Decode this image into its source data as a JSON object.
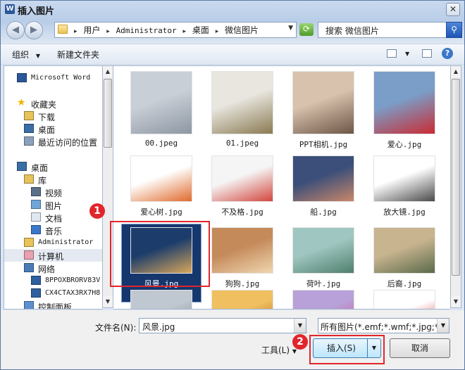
{
  "window": {
    "title": "插入图片",
    "app_icon": "W",
    "close_glyph": "✕"
  },
  "nav": {
    "back_glyph": "◀",
    "forward_glyph": "▶",
    "breadcrumbs": [
      "用户",
      "Administrator",
      "桌面",
      "微信图片"
    ],
    "search_placeholder": "搜索 微信图片"
  },
  "toolbar": {
    "organize": "组织",
    "new_folder": "新建文件夹",
    "help_glyph": "?"
  },
  "sidebar": {
    "items": [
      {
        "label": "Microsoft Word",
        "icon": "word-icon",
        "indent": 0
      },
      {
        "label": "收藏夹",
        "icon": "star-icon",
        "indent": 0
      },
      {
        "label": "下载",
        "icon": "download-folder-icon",
        "indent": 1
      },
      {
        "label": "桌面",
        "icon": "desktop-icon",
        "indent": 1
      },
      {
        "label": "最近访问的位置",
        "icon": "recent-places-icon",
        "indent": 1
      },
      {
        "label": "桌面",
        "icon": "desktop-icon",
        "indent": 0
      },
      {
        "label": "库",
        "icon": "library-icon",
        "indent": 1
      },
      {
        "label": "视频",
        "icon": "video-icon",
        "indent": 2
      },
      {
        "label": "图片",
        "icon": "pictures-icon",
        "indent": 2
      },
      {
        "label": "文档",
        "icon": "documents-icon",
        "indent": 2
      },
      {
        "label": "音乐",
        "icon": "music-icon",
        "indent": 2
      },
      {
        "label": "Administrator",
        "icon": "user-folder-icon",
        "indent": 1
      },
      {
        "label": "计算机",
        "icon": "computer-icon",
        "indent": 1
      },
      {
        "label": "网络",
        "icon": "network-icon",
        "indent": 1
      },
      {
        "label": "8PPOXBRORV83V",
        "icon": "network-pc-icon",
        "indent": 2
      },
      {
        "label": "CX4CTAX3RX7H8",
        "icon": "network-pc-icon",
        "indent": 2
      },
      {
        "label": "控制面板",
        "icon": "control-panel-icon",
        "indent": 1
      }
    ]
  },
  "files": [
    {
      "name": "00.jpeg",
      "c1": "#c9cfd6",
      "c2": "#8d96a3"
    },
    {
      "name": "01.jpeg",
      "c1": "#e8e6df",
      "c2": "#8a7a52"
    },
    {
      "name": "PPT相机.jpg",
      "c1": "#d8c2ad",
      "c2": "#6d5646"
    },
    {
      "name": "爱心.jpg",
      "c1": "#7a9ec8",
      "c2": "#c92b33"
    },
    {
      "name": "爱心树.jpg",
      "c1": "#ffffff",
      "c2": "#e06a2b"
    },
    {
      "name": "不及格.jpg",
      "c1": "#f5f5f5",
      "c2": "#d3463d"
    },
    {
      "name": "船.jpg",
      "c1": "#3b4f7a",
      "c2": "#c9866a"
    },
    {
      "name": "放大镜.jpg",
      "c1": "#ffffff",
      "c2": "#4a4a4a"
    },
    {
      "name": "风景.jpg",
      "c1": "#1c3d6b",
      "c2": "#d9a65a"
    },
    {
      "name": "狗狗.jpg",
      "c1": "#c48a5a",
      "c2": "#f0d6b0"
    },
    {
      "name": "荷叶.jpg",
      "c1": "#9fc6c0",
      "c2": "#4f7f6d"
    },
    {
      "name": "后裔.jpg",
      "c1": "#c8b48f",
      "c2": "#5a6a4a"
    },
    {
      "name": "",
      "c1": "#bfc7d0",
      "c2": "#7f8a96"
    },
    {
      "name": "",
      "c1": "#f0c060",
      "c2": "#b25a20"
    },
    {
      "name": "",
      "c1": "#b8a0d8",
      "c2": "#e04a8a"
    },
    {
      "name": "",
      "c1": "#ffffff",
      "c2": "#d03030"
    }
  ],
  "annotations": {
    "marker_1": "1",
    "marker_2": "2"
  },
  "bottom": {
    "filename_label": "文件名(N):",
    "filename_value": "风景.jpg",
    "filetype_value": "所有图片(*.emf;*.wmf;*.jpg;*.jp",
    "tools_label": "工具(L)",
    "insert_label": "插入(S)",
    "cancel_label": "取消"
  }
}
